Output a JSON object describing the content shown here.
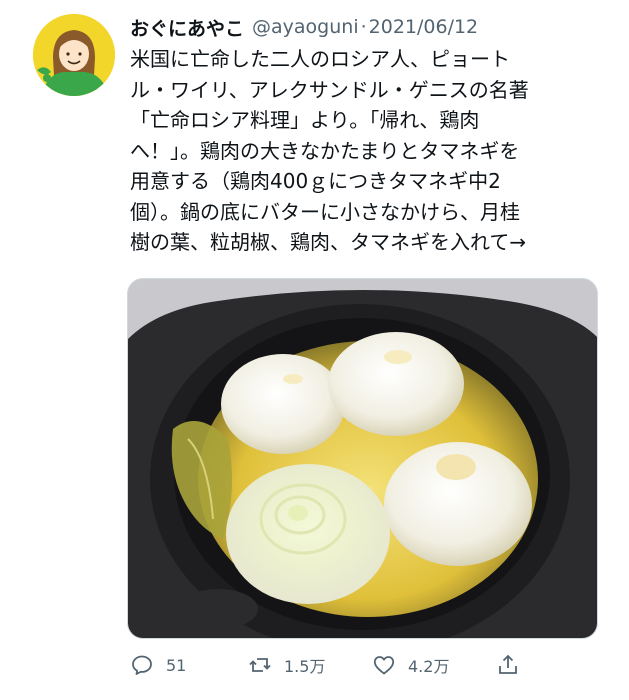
{
  "tweet": {
    "display_name": "おぐにあやこ",
    "handle": "@ayaoguni",
    "separator": "·",
    "date": "2021/06/12",
    "text_lines": [
      "米国に亡命した二人のロシア人、ピョート",
      "ル・ワイリ、アレクサンドル・ゲニスの名著",
      "「亡命ロシア料理」より。「帰れ、鶏肉",
      "へ！」。鶏肉の大きなかたまりとタマネギを",
      "用意する（鶏肉400ｇにつきタマネギ中2",
      "個）。鍋の底にバターに小さなかけら、月桂",
      "樹の葉、粒胡椒、鶏肉、タマネギを入れて→"
    ]
  },
  "actions": {
    "replies": "51",
    "retweets": "1.5万",
    "likes": "4.2万"
  },
  "icons": {
    "reply": "reply-icon",
    "retweet": "retweet-icon",
    "like": "heart-icon",
    "share": "share-icon"
  },
  "colors": {
    "text": "#0f1419",
    "secondary": "#536471",
    "avatar_bg": "#f3d62a"
  }
}
